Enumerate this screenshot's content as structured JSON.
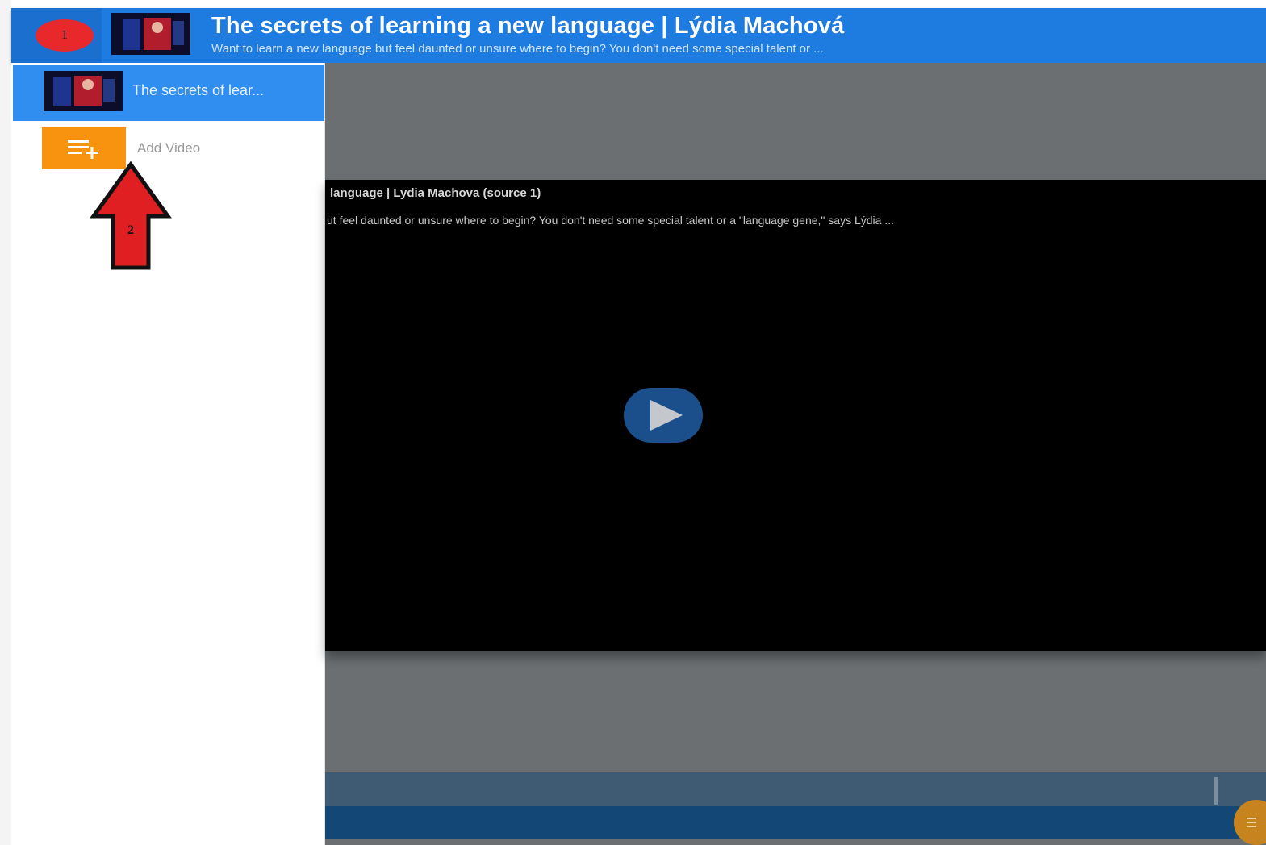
{
  "header": {
    "badge": "1",
    "title": "The secrets of learning a new language | Lýdia Machová",
    "subtitle": "Want to learn a new language but feel daunted or unsure where to begin? You don't need some special talent or ..."
  },
  "sidebar": {
    "playlist_item_label": "The secrets of lear...",
    "add_video_label": "Add Video",
    "annotation_number": "2"
  },
  "video": {
    "title": "language | Lydia Machova (source 1)",
    "description": "ut feel daunted or unsure where to begin? You don't need some special talent or a \"language gene,\" says Lýdia ..."
  },
  "colors": {
    "header_bg": "#1e7be0",
    "selected_item_bg": "#2f8ef0",
    "add_button_bg": "#f7930e",
    "annotation_red": "#e8282b",
    "player_bg": "#000000"
  },
  "icons": [
    "video-thumbnail",
    "playlist-add-icon",
    "play-icon",
    "up-arrow-annotation"
  ]
}
